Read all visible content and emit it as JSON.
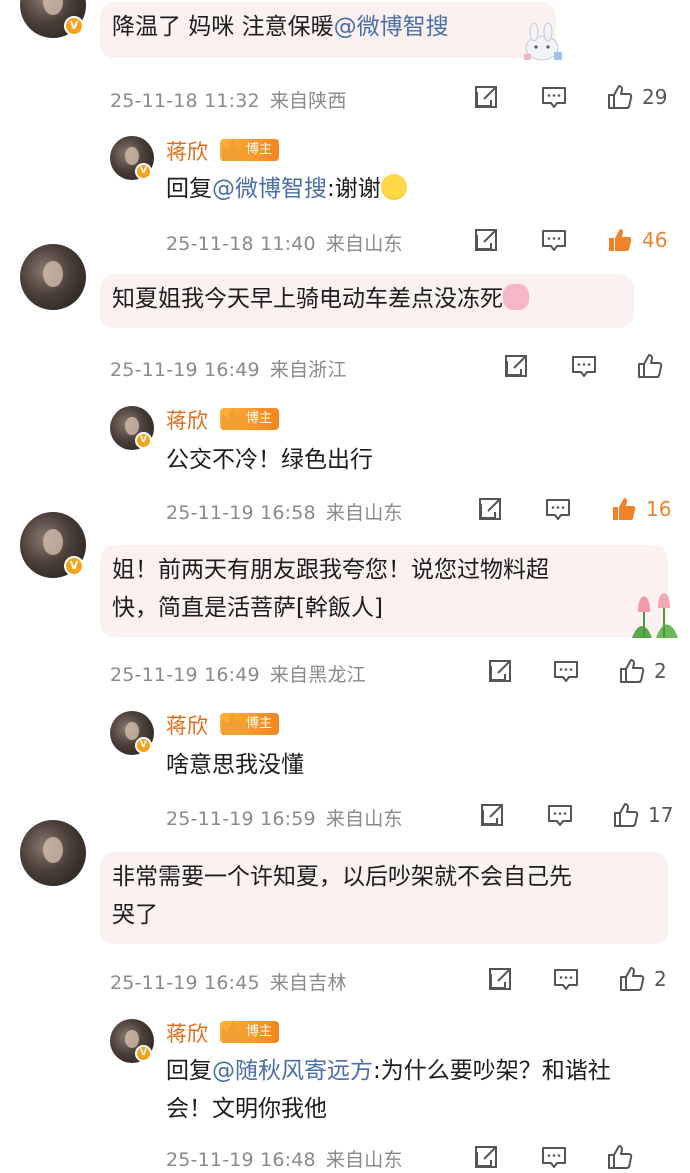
{
  "comments": [
    {
      "text": "降温了  妈咪  注意保暖",
      "mention": "@微博智搜",
      "time": "25-11-18 11:32",
      "location": "来自陕西",
      "likes": "29",
      "reply": {
        "author": "蒋欣",
        "badge": "博主",
        "prefix": "回复",
        "mention": "@微博智搜",
        "text": ":谢谢",
        "time": "25-11-18 11:40",
        "location": "来自山东",
        "likes": "46"
      }
    },
    {
      "text": "知夏姐我今天早上骑电动车差点没冻死",
      "time": "25-11-19 16:49",
      "location": "来自浙江",
      "likes": "",
      "reply": {
        "author": "蒋欣",
        "badge": "博主",
        "text": "公交不冷！绿色出行",
        "time": "25-11-19 16:58",
        "location": "来自山东",
        "likes": "16"
      }
    },
    {
      "text_line1": "姐！前两天有朋友跟我夸您！说您过物料超",
      "text_line2": "快，简直是活菩萨[幹飯人]",
      "time": "25-11-19 16:49",
      "location": "来自黑龙江",
      "likes": "2",
      "reply": {
        "author": "蒋欣",
        "badge": "博主",
        "text": "啥意思我没懂",
        "time": "25-11-19 16:59",
        "location": "来自山东",
        "likes": "17"
      }
    },
    {
      "text_line1": "非常需要一个许知夏，以后吵架就不会自己先",
      "text_line2": "哭了",
      "time": "25-11-19 16:45",
      "location": "来自吉林",
      "likes": "2",
      "reply": {
        "author": "蒋欣",
        "badge": "博主",
        "prefix": "回复",
        "mention": "@随秋风寄远方",
        "text_line1": ":为什么要吵架？和谐社",
        "text_line2": "会！文明你我他",
        "time": "25-11-19 16:48",
        "location": "来自山东",
        "likes": ""
      }
    }
  ],
  "colors": {
    "bubble": "#fbf1f1",
    "mention": "#4a6ea9",
    "author": "#e06c1a",
    "liked": "#f0832a",
    "meta": "#8a8a8a"
  },
  "icons": [
    "share-icon",
    "comment-icon",
    "thumbs-up-icon",
    "verified-icon",
    "crown-icon"
  ]
}
